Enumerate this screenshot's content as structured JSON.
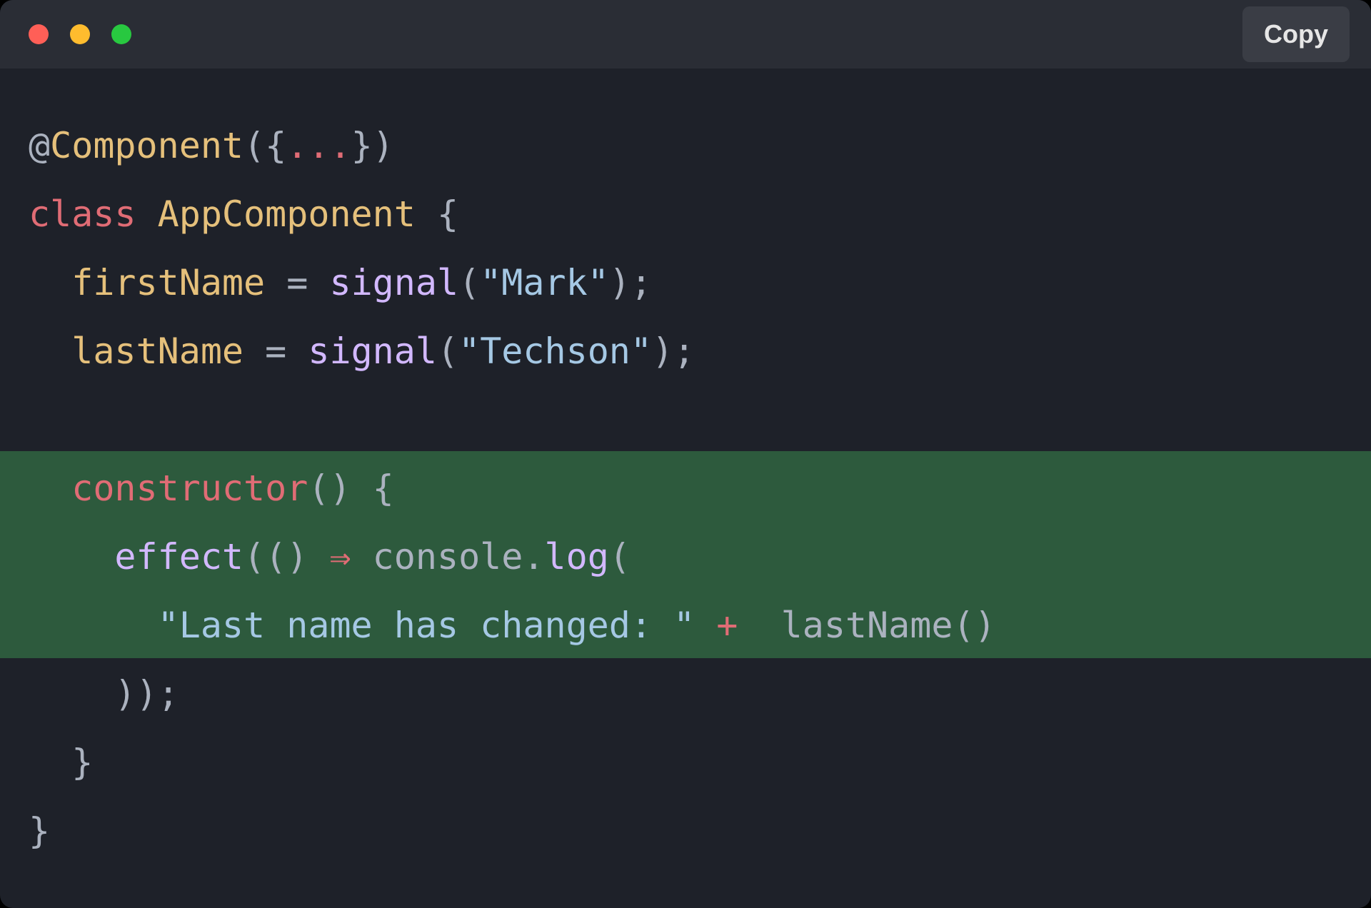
{
  "titlebar": {
    "copy_label": "Copy"
  },
  "code": {
    "decorator_at": "@",
    "decorator_name": "Component",
    "decorator_open": "({",
    "decorator_dots": "...",
    "decorator_close": "})",
    "class_keyword": "class",
    "class_name": "AppComponent",
    "brace_open": " {",
    "prop_firstName": "firstName",
    "prop_lastName": "lastName",
    "equals": " = ",
    "signal_func": "signal",
    "paren_open": "(",
    "string_mark": "\"Mark\"",
    "string_techson": "\"Techson\"",
    "paren_close_semi": ");",
    "constructor_kw": "constructor",
    "constructor_parens": "()",
    "constructor_brace": " {",
    "effect_func": "effect",
    "effect_open": "(()",
    "arrow": " ⇒ ",
    "console_obj": "console",
    "dot": ".",
    "log_func": "log",
    "log_open": "(",
    "string_msg": "\"Last name has changed: \"",
    "plus": " + ",
    "lastName_call": " lastName",
    "lastName_parens": "()",
    "effect_close": "));",
    "brace_close_inner": "}",
    "brace_close_outer": "}",
    "indent1": "  ",
    "indent2": "    ",
    "indent3": "      "
  }
}
